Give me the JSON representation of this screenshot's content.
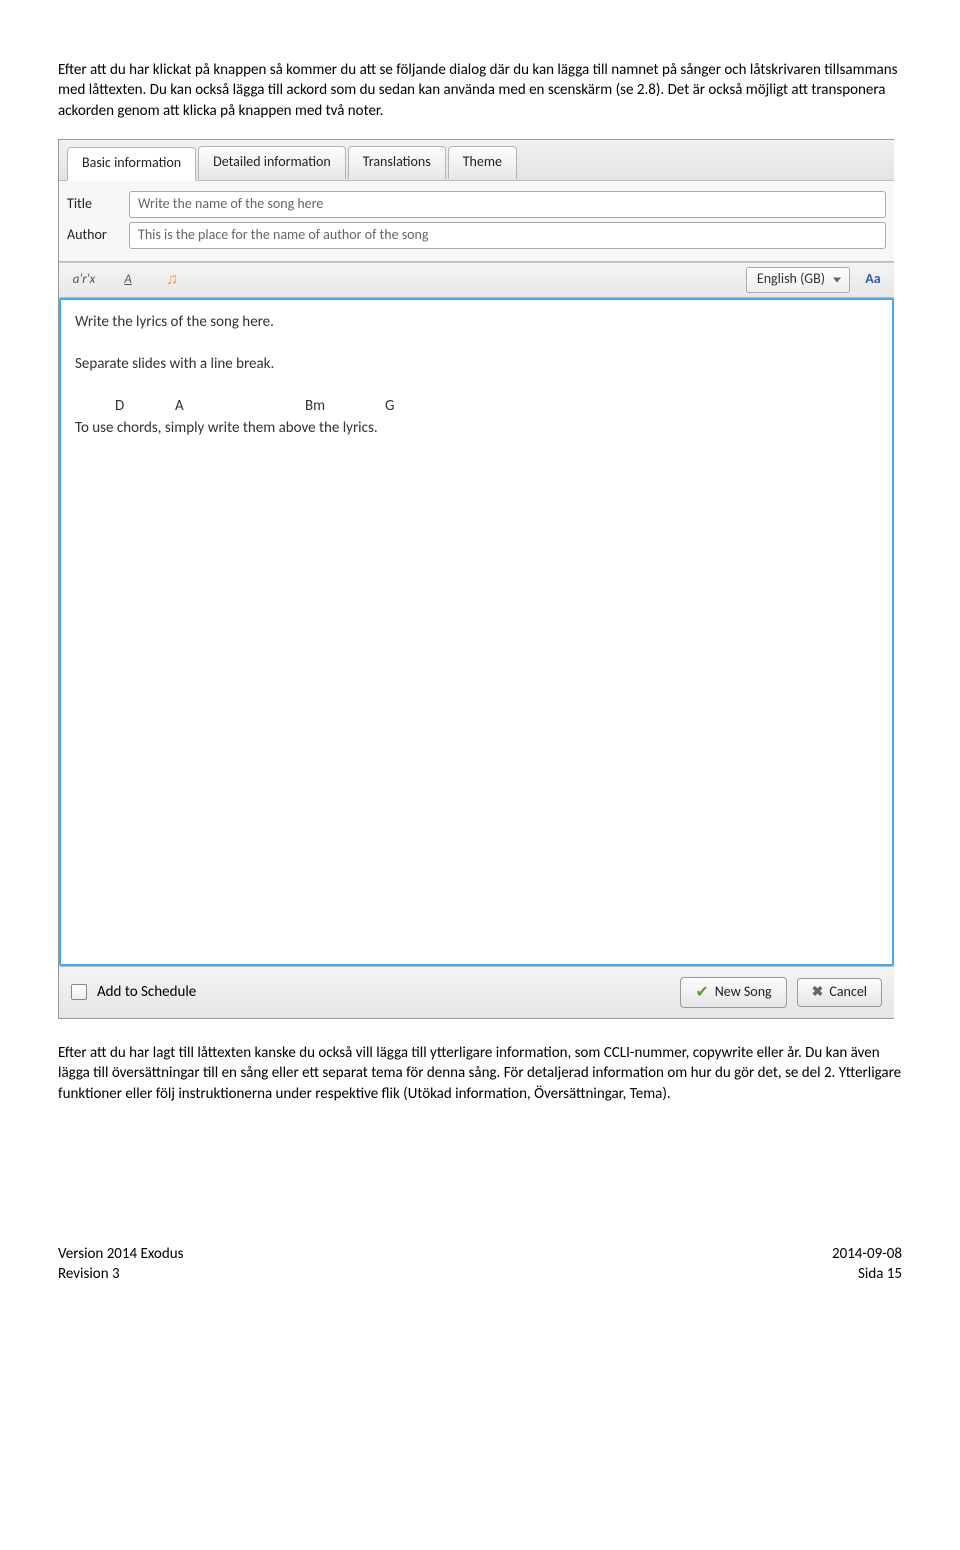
{
  "paragraph1": "Efter att du har klickat på knappen så kommer du att se följande dialog där du kan lägga till namnet på sånger och låtskrivaren tillsammans med låttexten. Du kan också lägga till ackord som du sedan kan använda med en scenskärm (se 2.8). Det är också möjligt att transponera ackorden genom att klicka på knappen med två noter.",
  "paragraph2": "Efter att du har lagt till låttexten kanske du också vill lägga till ytterligare information, som CCLI-nummer, copywrite eller år. Du kan även lägga till översättningar till en sång eller ett separat tema för denna sång. För detaljerad information om hur du gör det, se del 2. Ytterligare funktioner eller följ instruktionerna under respektive flik (Utökad information, Översättningar, Tema).",
  "dialog": {
    "tabs": [
      "Basic information",
      "Detailed information",
      "Translations",
      "Theme"
    ],
    "title_label": "Title",
    "title_value": "Write the name of the song here",
    "author_label": "Author",
    "author_value": "This is the place for the name of author of the song",
    "toolbar": {
      "btn1": "a'r'x",
      "btn2": "A",
      "lang": "English (GB)",
      "aa": "Aa"
    },
    "lyrics": {
      "line1": "Write the lyrics of the song here.",
      "line2": "Separate slides with a line break.",
      "chords": {
        "c1": "D",
        "c2": "A",
        "c3": "Bm",
        "c4": "G"
      },
      "line3": "To use chords, simply write them above the lyrics."
    },
    "bottom": {
      "schedule": "Add to Schedule",
      "new_song": "New Song",
      "cancel": "Cancel"
    }
  },
  "footer": {
    "version": "Version 2014 Exodus",
    "revision": "Revision 3",
    "date": "2014-09-08",
    "page": "Sida 15"
  }
}
